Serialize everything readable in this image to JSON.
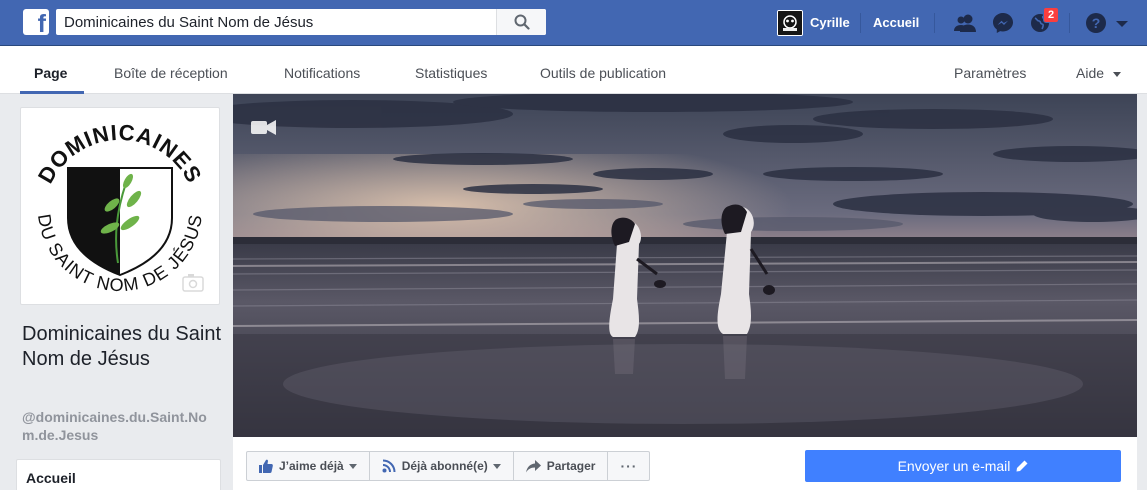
{
  "topbar": {
    "search_value": "Dominicaines du Saint Nom de Jésus",
    "user_name": "Cyrille",
    "home_label": "Accueil",
    "notification_count": "2",
    "brand_color": "#4267b2"
  },
  "pagenav": {
    "tabs": [
      {
        "label": "Page",
        "active": true
      },
      {
        "label": "Boîte de réception"
      },
      {
        "label": "Notifications"
      },
      {
        "label": "Statistiques"
      },
      {
        "label": "Outils de publication"
      }
    ],
    "settings_label": "Paramètres",
    "help_label": "Aide"
  },
  "profile": {
    "logo_text_top": "DOMINICAINES",
    "logo_text_bottom": "DU SAINT NOM DE JÉSUS",
    "page_name": "Dominicaines du Saint Nom de Jésus",
    "handle": "@dominicaines.du.Saint.Nom.de.Jesus"
  },
  "left_menu": {
    "items": [
      {
        "label": "Accueil"
      }
    ]
  },
  "actions": {
    "like_label": "J’aime déjà",
    "follow_label": "Déjà abonné(e)",
    "share_label": "Partager",
    "more_label": "···",
    "email_label": "Envoyer un e-mail"
  },
  "icons": {
    "cover": "video-camera-icon",
    "profile": "camera-icon"
  },
  "colors": {
    "accent": "#4080ff",
    "badge": "#fa3e3e"
  }
}
